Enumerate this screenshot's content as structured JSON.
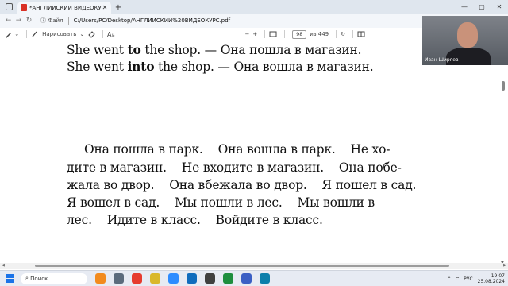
{
  "browser": {
    "tab_title": "*АНГЛИЙСКИЙ ВИДЕОКУРС.pdf",
    "tab_close": "✕",
    "new_tab": "+",
    "address_label": "Файл",
    "address_url": "C:/Users/PC/Desktop/АНГЛИЙСКИЙ%20ВИДЕОКУРС.pdf"
  },
  "pdf_toolbar": {
    "draw_label": "Нарисовать",
    "page_current": "98",
    "page_total": "из 449",
    "zoom_minus": "−",
    "zoom_plus": "+"
  },
  "document": {
    "line1_pre": "She went ",
    "line1_bold": "to",
    "line1_post": " the shop. — Она пошла в магазин.",
    "line2_pre": "She went ",
    "line2_bold": "into",
    "line2_post": " the shop. — Она вошла в магазин.",
    "para": [
      "Она пошла в парк.    Она вошла в парк.    Не хо-",
      "дите в магазин.    Не входите в магазин.    Она побе-",
      "жала во двор.    Она вбежала во двор.    Я пошел в сад.",
      "Я вошел в сад.    Мы пошли в лес.    Мы вошли в",
      "лес.    Идите в класс.    Войдите в класс."
    ]
  },
  "webcam": {
    "name": "Иван Ширяев"
  },
  "taskbar": {
    "search_placeholder": "Поиск",
    "language": "РУС",
    "time": "19:07",
    "date": "25.08.2024"
  },
  "icons": [
    "pdf-icon",
    "back-icon",
    "forward-icon",
    "refresh-icon",
    "info-icon",
    "highlight-icon",
    "draw-icon",
    "erase-icon",
    "text-icon",
    "read-aloud-icon",
    "fit-page-icon",
    "rotate-icon",
    "windows-start-icon",
    "search-icon"
  ]
}
